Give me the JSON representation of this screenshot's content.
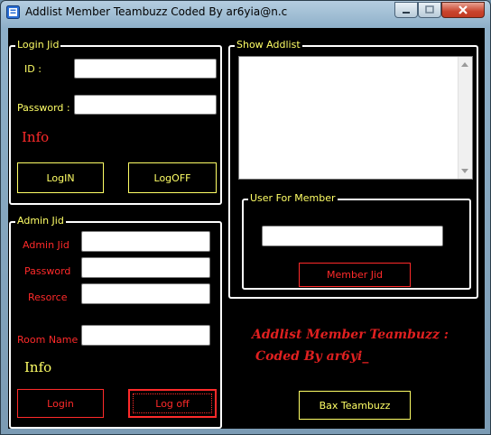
{
  "window": {
    "title": "Addlist Member Teambuzz Coded By ar6yia@n.c"
  },
  "login_group": {
    "legend": "Login Jid",
    "id_label": "ID :",
    "password_label": "Password :",
    "id_value": "",
    "password_value": "",
    "info": "Info",
    "login_button": "LogIN",
    "logoff_button": "LogOFF"
  },
  "admin_group": {
    "legend": "Admin Jid",
    "admin_jid_label": "Admin Jid",
    "password_label": "Password",
    "resorce_label": "Resorce",
    "room_name_label": "Room Name",
    "info": "Info",
    "login_button": "Login",
    "logoff_button": "Log off"
  },
  "addlist_group": {
    "legend": "Show Addlist"
  },
  "member_group": {
    "legend": "User For Member",
    "member_button": "Member Jid"
  },
  "credits": {
    "line1": "Addlist Member Teambuzz :",
    "line2": "Coded By ar6yi_"
  },
  "bax_button": "Bax Teambuzz",
  "colors": {
    "accent_yellow": "#ffff66",
    "accent_red": "#ff2a2a",
    "background": "#000000"
  }
}
